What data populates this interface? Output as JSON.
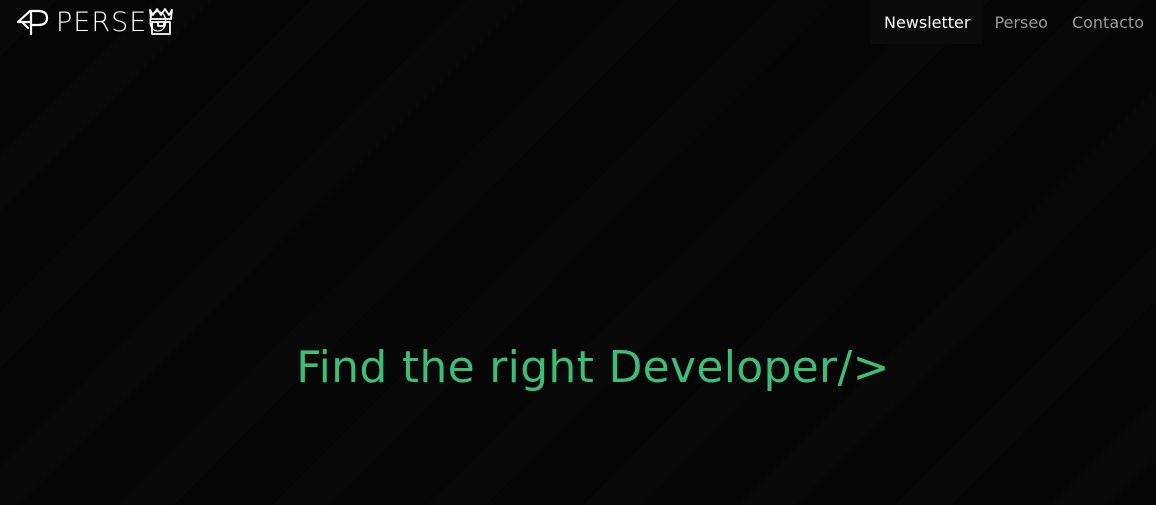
{
  "brand": {
    "logo_text": "PERSEO",
    "logo_icon": "perseo-logo-icon",
    "crown_icon": "crown-icon"
  },
  "nav": {
    "items": [
      {
        "label": "Newsletter",
        "active": true
      },
      {
        "label": "Perseo",
        "active": false
      },
      {
        "label": "Contacto",
        "active": false
      }
    ]
  },
  "hero": {
    "title": "Find the right Developer/>"
  },
  "colors": {
    "background": "#050505",
    "accent": "#3dbd78",
    "nav_active": "#ffffff",
    "nav_inactive": "#9a9a9a"
  }
}
